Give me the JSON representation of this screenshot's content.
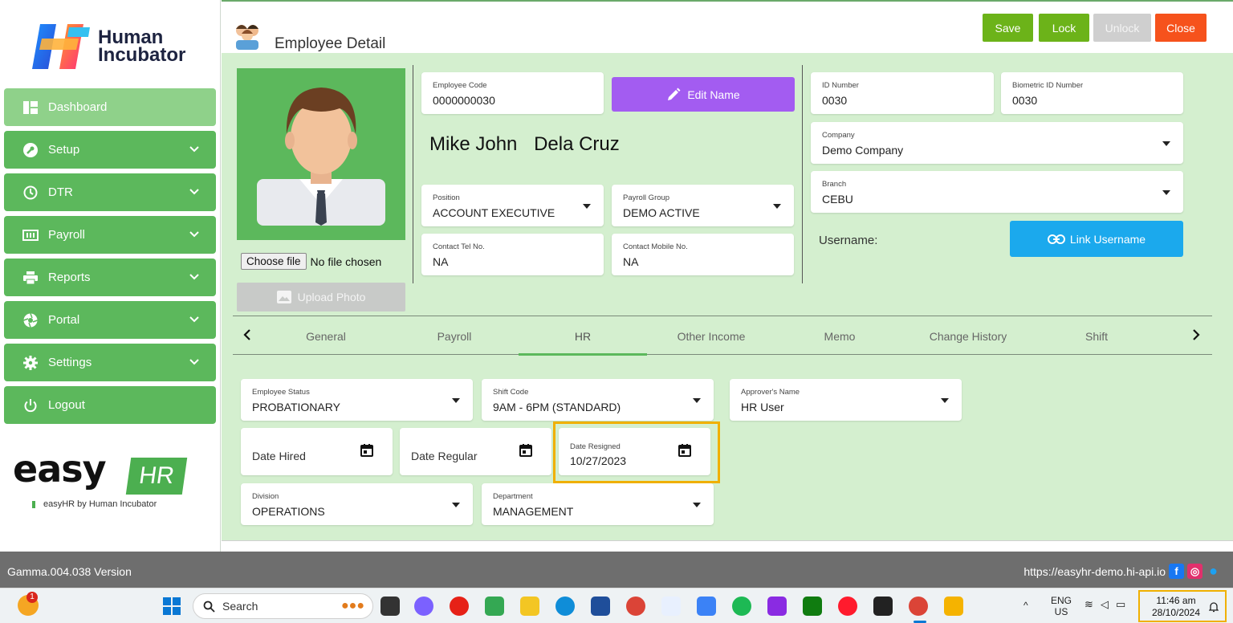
{
  "brand": {
    "line1": "Human",
    "line2": "Incubator",
    "easy_word": "easy",
    "hr_word": "HR",
    "tagline": "easyHR by Human Incubator"
  },
  "sidebar": {
    "items": [
      {
        "label": "Dashboard",
        "icon": "dashboard-icon",
        "active": true
      },
      {
        "label": "Setup",
        "icon": "wrench-icon"
      },
      {
        "label": "DTR",
        "icon": "clock-icon"
      },
      {
        "label": "Payroll",
        "icon": "money-icon"
      },
      {
        "label": "Reports",
        "icon": "printer-icon"
      },
      {
        "label": "Portal",
        "icon": "aperture-icon"
      },
      {
        "label": "Settings",
        "icon": "gear-icon"
      },
      {
        "label": "Logout",
        "icon": "power-icon"
      }
    ]
  },
  "header": {
    "title": "Employee Detail",
    "buttons": {
      "save": "Save",
      "lock": "Lock",
      "unlock": "Unlock",
      "close": "Close"
    },
    "colors": {
      "save": "#6cb319",
      "lock": "#6cb319",
      "unlock": "#cfcfcf",
      "close": "#f6521c"
    }
  },
  "employee": {
    "code_label": "Employee Code",
    "code": "0000000030",
    "edit_name": "Edit Name",
    "first_name": "Mike John",
    "last_name": "Dela Cruz",
    "position_label": "Position",
    "position": "ACCOUNT EXECUTIVE",
    "payroll_group_label": "Payroll Group",
    "payroll_group": "DEMO ACTIVE",
    "tel_label": "Contact Tel No.",
    "tel": "NA",
    "mobile_label": "Contact Mobile No.",
    "mobile": "NA",
    "id_label": "ID Number",
    "id": "0030",
    "bio_label": "Biometric ID Number",
    "bio": "0030",
    "company_label": "Company",
    "company": "Demo Company",
    "branch_label": "Branch",
    "branch": "CEBU",
    "username_label": "Username:",
    "link_username": "Link Username",
    "choose_file": "Choose file",
    "no_file": "No file chosen",
    "upload_photo": "Upload Photo"
  },
  "tabs": [
    "General",
    "Payroll",
    "HR",
    "Other Income",
    "Memo",
    "Change History",
    "Shift"
  ],
  "hr": {
    "status_label": "Employee Status",
    "status": "PROBATIONARY",
    "shift_label": "Shift Code",
    "shift": "9AM - 6PM (STANDARD)",
    "approver_label": "Approver's Name",
    "approver": "HR User",
    "date_hired": "Date Hired",
    "date_regular": "Date Regular",
    "date_resigned_label": "Date Resigned",
    "date_resigned": "10/27/2023",
    "division_label": "Division",
    "division": "OPERATIONS",
    "department_label": "Department",
    "department": "MANAGEMENT"
  },
  "footer": {
    "version": "Gamma.004.038 Version",
    "url": "https://easyhr-demo.hi-api.io"
  },
  "taskbar": {
    "search": "Search",
    "weather_badge": "1",
    "lang1": "ENG",
    "lang2": "US",
    "time": "11:46 am",
    "date": "28/10/2024"
  }
}
